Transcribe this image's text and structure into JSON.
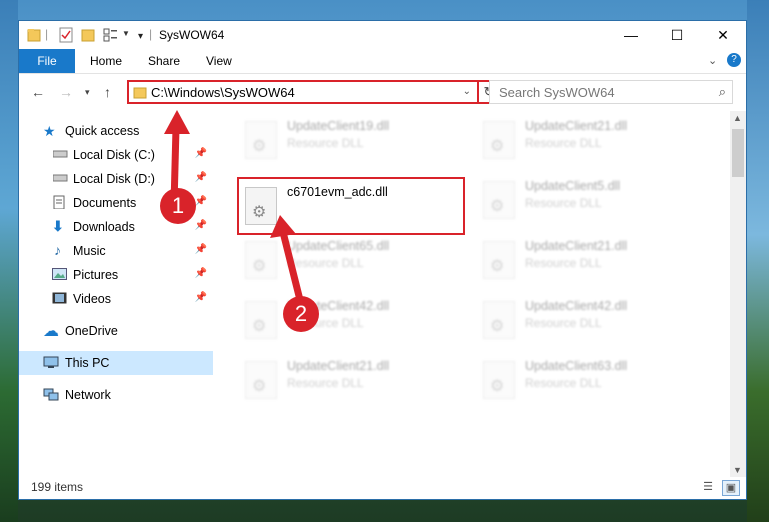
{
  "window": {
    "title": "SysWOW64"
  },
  "ribbon": {
    "tabs": [
      "File",
      "Home",
      "Share",
      "View"
    ]
  },
  "address": {
    "path": "C:\\Windows\\SysWOW64"
  },
  "search": {
    "placeholder": "Search SysWOW64"
  },
  "nav": {
    "items": [
      {
        "label": "Quick access"
      },
      {
        "label": "Local Disk (C:)"
      },
      {
        "label": "Local Disk (D:)"
      },
      {
        "label": "Documents"
      },
      {
        "label": "Downloads"
      },
      {
        "label": "Music"
      },
      {
        "label": "Pictures"
      },
      {
        "label": "Videos"
      },
      {
        "label": "OneDrive"
      },
      {
        "label": "This PC"
      },
      {
        "label": "Network"
      }
    ]
  },
  "files": [
    {
      "name": "UpdateClient19.dll",
      "type": "Resource DLL"
    },
    {
      "name": "UpdateClient21.dll",
      "type": "Resource DLL"
    },
    {
      "name": "c6701evm_adc.dll",
      "type": ""
    },
    {
      "name": "UpdateClient5.dll",
      "type": "Resource DLL"
    },
    {
      "name": "UpdateClient65.dll",
      "type": "Resource DLL"
    },
    {
      "name": "UpdateClient21.dll",
      "type": "Resource DLL"
    },
    {
      "name": "UpdateClient42.dll",
      "type": "Resource DLL"
    },
    {
      "name": "UpdateClient42.dll",
      "type": "Resource DLL"
    },
    {
      "name": "UpdateClient21.dll",
      "type": "Resource DLL"
    },
    {
      "name": "UpdateClient63.dll",
      "type": "Resource DLL"
    }
  ],
  "status": {
    "item_count": "199 items"
  },
  "annotations": {
    "step1": "1",
    "step2": "2"
  },
  "colors": {
    "accent": "#1979ca",
    "highlight": "#d9232a",
    "selected": "#cce8ff"
  }
}
